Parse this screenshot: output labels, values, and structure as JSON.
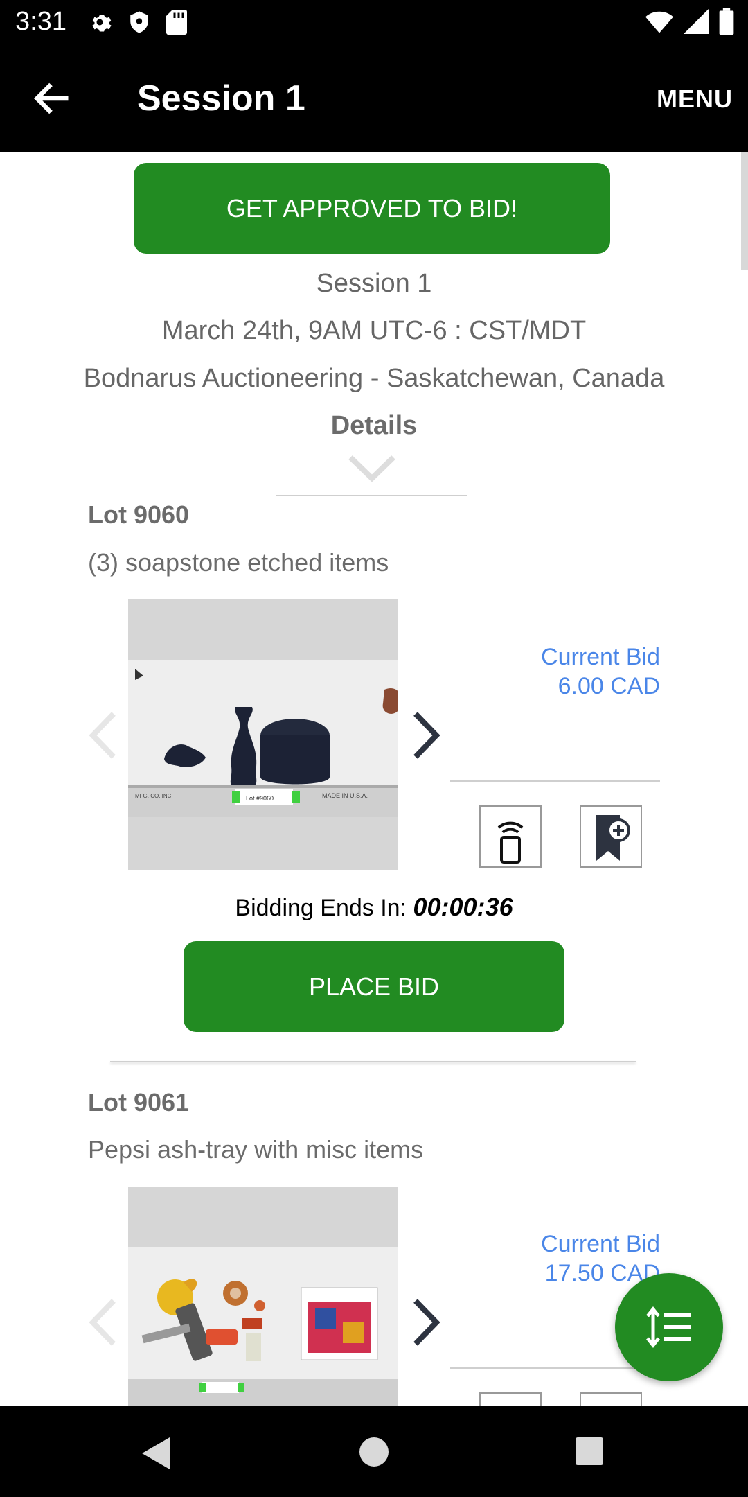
{
  "status_bar": {
    "time": "3:31"
  },
  "app_bar": {
    "title": "Session 1",
    "menu_label": "MENU"
  },
  "approve_button": {
    "label": "GET APPROVED TO BID!"
  },
  "session": {
    "name": "Session 1",
    "date": "March 24th, 9AM UTC-6 : CST/MDT",
    "auctioneer": "Bodnarus Auctioneering - Saskatchewan, Canada",
    "details_label": "Details"
  },
  "lots": [
    {
      "title": "Lot 9060",
      "description": "(3) soapstone etched items",
      "bid_label": "Current Bid",
      "bid_value": "6.00 CAD",
      "timer_label": "Bidding Ends In:",
      "timer_value": "00:00:36",
      "place_bid_label": "PLACE BID"
    },
    {
      "title": "Lot 9061",
      "description": "Pepsi ash-tray with misc items",
      "bid_label": "Current Bid",
      "bid_value": "17.50 CAD"
    }
  ],
  "colors": {
    "accent_green": "#228b22",
    "bid_blue": "#4a86e8"
  }
}
